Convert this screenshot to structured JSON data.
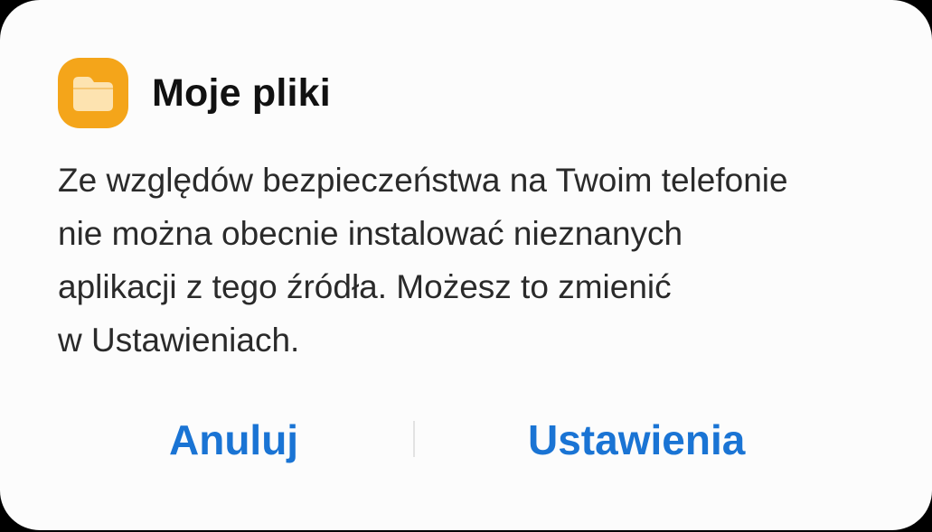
{
  "dialog": {
    "app_icon": "folder-icon",
    "app_name": "Moje pliki",
    "message_lines": [
      "Ze względów bezpieczeństwa na Twoim telefonie",
      "nie można obecnie instalować nieznanych",
      "aplikacji z tego źródła. Możesz to zmienić",
      "w Ustawieniach."
    ],
    "cancel_label": "Anuluj",
    "settings_label": "Ustawienia"
  },
  "colors": {
    "accent": "#1a74d4",
    "icon_background": "#f4a51a",
    "folder": "#fde3b0",
    "dialog_background": "#fcfcfc"
  }
}
